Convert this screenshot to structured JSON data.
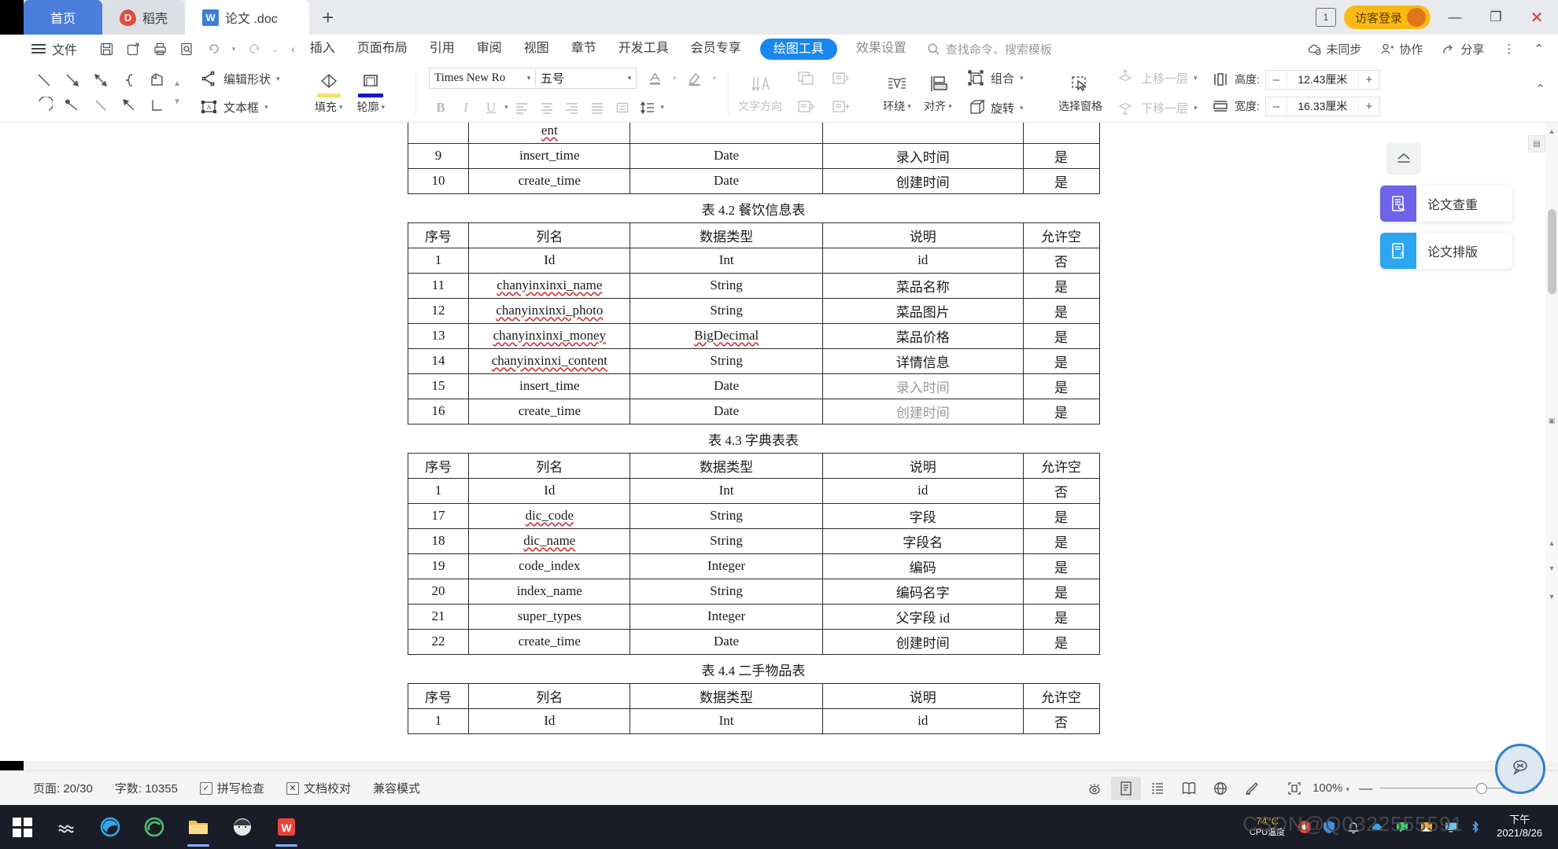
{
  "window": {
    "tabs": [
      {
        "label": "首页",
        "icon": "home-icon",
        "state": "home"
      },
      {
        "label": "稻壳",
        "icon": "docer-icon",
        "state": "inactive"
      },
      {
        "label": "论文 .doc",
        "icon": "wps-writer-icon",
        "state": "active"
      }
    ],
    "new_tab_label": "+",
    "notification_count": "1",
    "login_label": "访客登录",
    "minimize": "—",
    "maximize": "❐",
    "close": "✕"
  },
  "menubar": {
    "file_label": "文件",
    "quick_access": [
      "save-icon",
      "save-as-icon",
      "print-icon",
      "print-preview-icon",
      "undo-icon",
      "undo-caret",
      "redo-icon",
      "customize-caret"
    ],
    "scroll_left": "‹",
    "items": [
      {
        "label": "插入"
      },
      {
        "label": "页面布局"
      },
      {
        "label": "引用"
      },
      {
        "label": "审阅"
      },
      {
        "label": "视图"
      },
      {
        "label": "章节"
      },
      {
        "label": "开发工具"
      },
      {
        "label": "会员专享"
      }
    ],
    "active_pill": "绘图工具",
    "effect_settings": "效果设置",
    "search_placeholder": "查找命令、搜索模板",
    "right_items": [
      {
        "label": "未同步",
        "icon": "cloud-sync-icon"
      },
      {
        "label": "协作",
        "icon": "collaborate-icon"
      },
      {
        "label": "分享",
        "icon": "share-icon"
      }
    ],
    "more_label": "⋮",
    "collapse_label": "⌃"
  },
  "ribbon": {
    "shapes_row1": [
      "line-icon",
      "arrow-icon",
      "double-arrow-icon",
      "curve-icon",
      "freeform-icon"
    ],
    "shapes_row2": [
      "arc-icon",
      "scribble-icon",
      "thin-line-icon",
      "back-arrow-icon",
      "elbow-connector-icon"
    ],
    "edit_shape": "编辑形状",
    "text_box": "文本框",
    "fill": "填充",
    "outline": "轮廓",
    "font_name": "Times New Ro",
    "font_size": "五号",
    "font_color_icon": "font-color-icon",
    "highlight_icon": "highlight-icon",
    "bold": "B",
    "italic": "I",
    "underline": "U",
    "align_left_icon": "align-left-icon",
    "align_center_icon": "align-center-icon",
    "align_right_icon": "align-right-icon",
    "align_justify_icon": "align-justify-icon",
    "distribute_icon": "distribute-icon",
    "line_spacing_icon": "line-spacing-icon",
    "text_direction": "文字方向",
    "wrap": "环绕",
    "align": "对齐",
    "rotate": "旋转",
    "group": "组合",
    "selection_pane": "选择窗格",
    "bring_forward": "上移一层",
    "send_backward": "下移一层",
    "height_label": "高度:",
    "height_value": "12.43厘米",
    "width_label": "宽度:",
    "width_value": "16.33厘米",
    "stepper_minus": "–",
    "stepper_plus": "+"
  },
  "document": {
    "columns": [
      "序号",
      "列名",
      "数据类型",
      "说明",
      "允许空"
    ],
    "top_partial": {
      "orphan_cell": "ent",
      "rows": [
        [
          "9",
          "insert_time",
          "Date",
          "录入时间",
          "是"
        ],
        [
          "10",
          "create_time",
          "Date",
          "创建时间",
          "是"
        ]
      ]
    },
    "tables": [
      {
        "caption": "表 4.2 餐饮信息表",
        "rows": [
          [
            "1",
            "Id",
            "Int",
            "id",
            "否"
          ],
          [
            "11",
            "chanyinxinxi_name",
            "String",
            "菜品名称",
            "是"
          ],
          [
            "12",
            "chanyinxinxi_photo",
            "String",
            "菜品图片",
            "是"
          ],
          [
            "13",
            "chanyinxinxi_money",
            "BigDecimal",
            "菜品价格",
            "是"
          ],
          [
            "14",
            "chanyinxinxi_content",
            "String",
            "详情信息",
            "是"
          ],
          [
            "15",
            "insert_time",
            "Date",
            "录入时间",
            "是"
          ],
          [
            "16",
            "create_time",
            "Date",
            "创建时间",
            "是"
          ]
        ]
      },
      {
        "caption": "表 4.3 字典表表",
        "rows": [
          [
            "1",
            "Id",
            "Int",
            "id",
            "否"
          ],
          [
            "17",
            "dic_code",
            "String",
            "字段",
            "是"
          ],
          [
            "18",
            "dic_name",
            "String",
            "字段名",
            "是"
          ],
          [
            "19",
            "code_index",
            "Integer",
            "编码",
            "是"
          ],
          [
            "20",
            "index_name",
            "String",
            "编码名字",
            "是"
          ],
          [
            "21",
            "super_types",
            "Integer",
            "父字段 id",
            "是"
          ],
          [
            "22",
            "create_time",
            "Date",
            "创建时间",
            "是"
          ]
        ]
      },
      {
        "caption": "表 4.4 二手物品表",
        "rows": [
          [
            "1",
            "Id",
            "Int",
            "id",
            "否"
          ]
        ]
      }
    ]
  },
  "float_panel": {
    "collapse_icon": "collapse-panel-icon",
    "cards": [
      {
        "label": "论文查重",
        "icon": "paper-check-icon",
        "color": "#6c63e8"
      },
      {
        "label": "论文排版",
        "icon": "paper-format-icon",
        "color": "#2da6f0"
      }
    ]
  },
  "status": {
    "page_label": "页面: 20/30",
    "word_count": "字数: 10355",
    "spell_check": "拼写检查",
    "doc_proof": "文档校对",
    "compat_mode": "兼容模式",
    "view_icons": [
      "eye-icon",
      "page-view-icon",
      "outline-view-icon",
      "reading-view-icon",
      "web-view-icon",
      "edit-pen-icon",
      "fit-page-icon"
    ],
    "zoom_level": "100%",
    "zoom_out": "—",
    "zoom_in": "+",
    "assistant_icon": "assistant-icon"
  },
  "taskbar": {
    "start_icon": "windows-start-icon",
    "apps": [
      "search-icon",
      "edge-icon",
      "browser-icon",
      "explorer-icon",
      "ninja-icon",
      "wps-icon"
    ],
    "cpu_temp": "74°C",
    "cpu_label": "CPU温度",
    "tray_icons": [
      "chrome-icon",
      "shield-icon",
      "bell-icon",
      "cloud-icon",
      "chat-icon",
      "photo-icon",
      "monitor-icon",
      "bluetooth-icon"
    ],
    "clock_time": "下午",
    "clock_date": "2021/8/26",
    "watermark": "CSDN@Q0322555591"
  },
  "colors": {
    "accent": "#1a86ef",
    "home_tab": "#4a7ddc",
    "login": "#fdb913",
    "taskbar": "#1a1c27"
  }
}
